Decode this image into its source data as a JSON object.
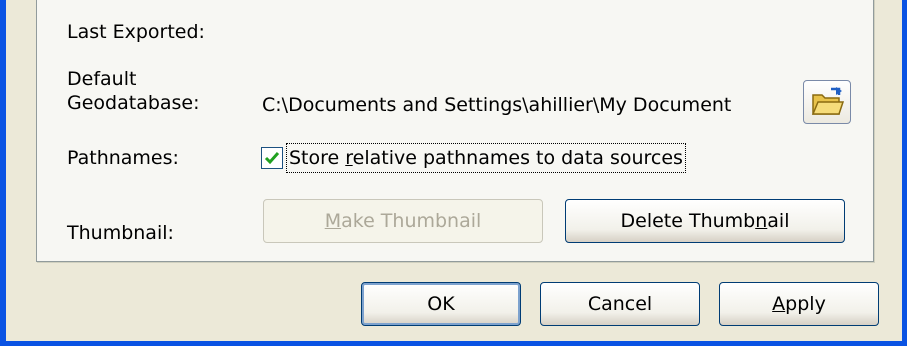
{
  "labels": {
    "last_exported": "Last Exported:",
    "default_geodatabase_line1": "Default",
    "default_geodatabase_line2": "Geodatabase:",
    "pathnames": "Pathnames:",
    "thumbnail": "Thumbnail:"
  },
  "values": {
    "last_exported": "",
    "default_geodatabase": "C:\\Documents and Settings\\ahillier\\My Document"
  },
  "pathnames_checkbox": {
    "checked": true,
    "label_pre": "Store ",
    "label_underline": "r",
    "label_post": "elative pathnames to data sources"
  },
  "thumbnail_buttons": {
    "make_pre": "",
    "make_underline": "M",
    "make_post": "ake Thumbnail",
    "delete_pre": "Delete Thumb",
    "delete_underline": "n",
    "delete_post": "ail"
  },
  "dialog_buttons": {
    "ok": "OK",
    "cancel": "Cancel",
    "apply_underline": "A",
    "apply_post": "pply"
  },
  "icons": {
    "browse": "open-folder-icon",
    "check": "checkmark-icon"
  },
  "colors": {
    "window_frame": "#0a53e3",
    "dialog_background": "#ece9d8",
    "panel_background": "#f7f7f3",
    "checkmark": "#21a121"
  }
}
